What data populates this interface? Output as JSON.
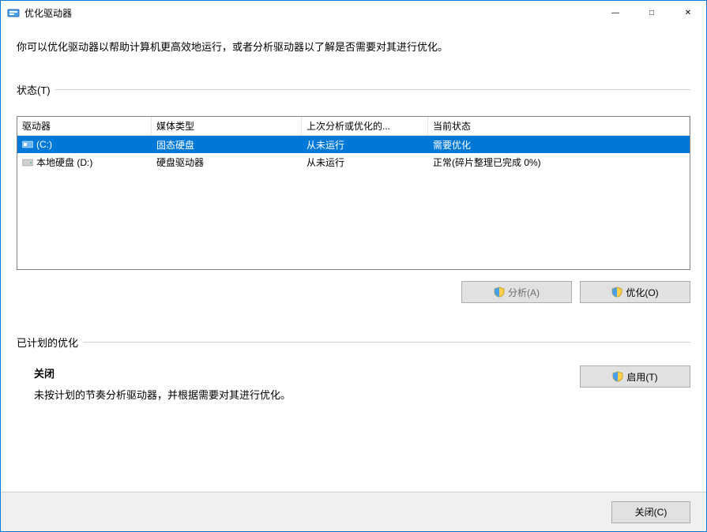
{
  "window": {
    "title": "优化驱动器"
  },
  "description": "你可以优化驱动器以帮助计算机更高效地运行，或者分析驱动器以了解是否需要对其进行优化。",
  "status": {
    "legend": "状态(T)",
    "headers": {
      "drive": "驱动器",
      "media": "媒体类型",
      "last": "上次分析或优化的...",
      "state": "当前状态"
    },
    "rows": [
      {
        "drive": "(C:)",
        "media": "固态硬盘",
        "last": "从未运行",
        "state": "需要优化",
        "selected": true,
        "icon": "ssd"
      },
      {
        "drive": "本地硬盘 (D:)",
        "media": "硬盘驱动器",
        "last": "从未运行",
        "state": "正常(碎片整理已完成 0%)",
        "selected": false,
        "icon": "hdd"
      }
    ],
    "buttons": {
      "analyze": "分析(A)",
      "optimize": "优化(O)"
    }
  },
  "schedule": {
    "legend": "已计划的优化",
    "status_title": "关闭",
    "status_desc": "未按计划的节奏分析驱动器，并根据需要对其进行优化。",
    "enable_label": "启用(T)"
  },
  "footer": {
    "close_label": "关闭(C)"
  }
}
